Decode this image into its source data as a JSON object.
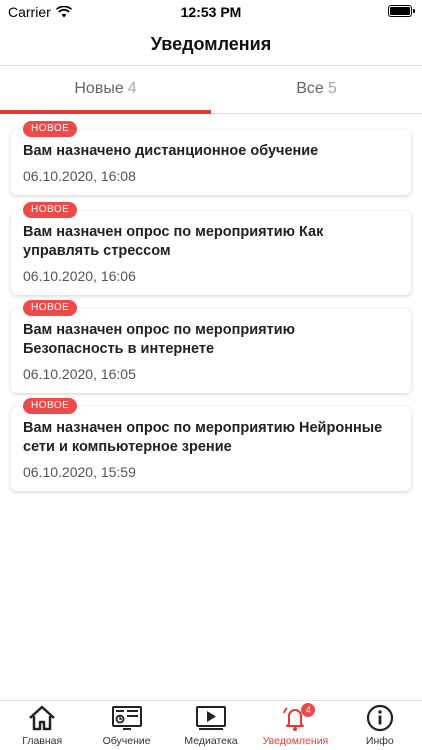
{
  "status": {
    "carrier": "Carrier",
    "time": "12:53 PM"
  },
  "header": {
    "title": "Уведомления"
  },
  "tabs": [
    {
      "label": "Новые",
      "count": "4"
    },
    {
      "label": "Все",
      "count": "5"
    }
  ],
  "badge_label": "НОВОЕ",
  "notifications": [
    {
      "title": "Вам назначено дистанционное обучение",
      "date": "06.10.2020, 16:08"
    },
    {
      "title": "Вам назначен опрос по мероприятию Как управлять стрессом",
      "date": "06.10.2020, 16:06"
    },
    {
      "title": "Вам назначен опрос по мероприятию Безопасность в интернете",
      "date": "06.10.2020, 16:05"
    },
    {
      "title": "Вам назначен опрос по мероприятию Нейронные сети и компьютерное зрение",
      "date": "06.10.2020, 15:59"
    }
  ],
  "nav": {
    "items": [
      {
        "label": "Главная",
        "icon": "home-icon"
      },
      {
        "label": "Обучение",
        "icon": "course-icon"
      },
      {
        "label": "Медиатека",
        "icon": "media-icon"
      },
      {
        "label": "Уведомления",
        "icon": "bell-icon",
        "badge": "4"
      },
      {
        "label": "Инфо",
        "icon": "info-icon"
      }
    ]
  },
  "colors": {
    "accent": "#e53935",
    "badge": "#ef4a4a"
  }
}
